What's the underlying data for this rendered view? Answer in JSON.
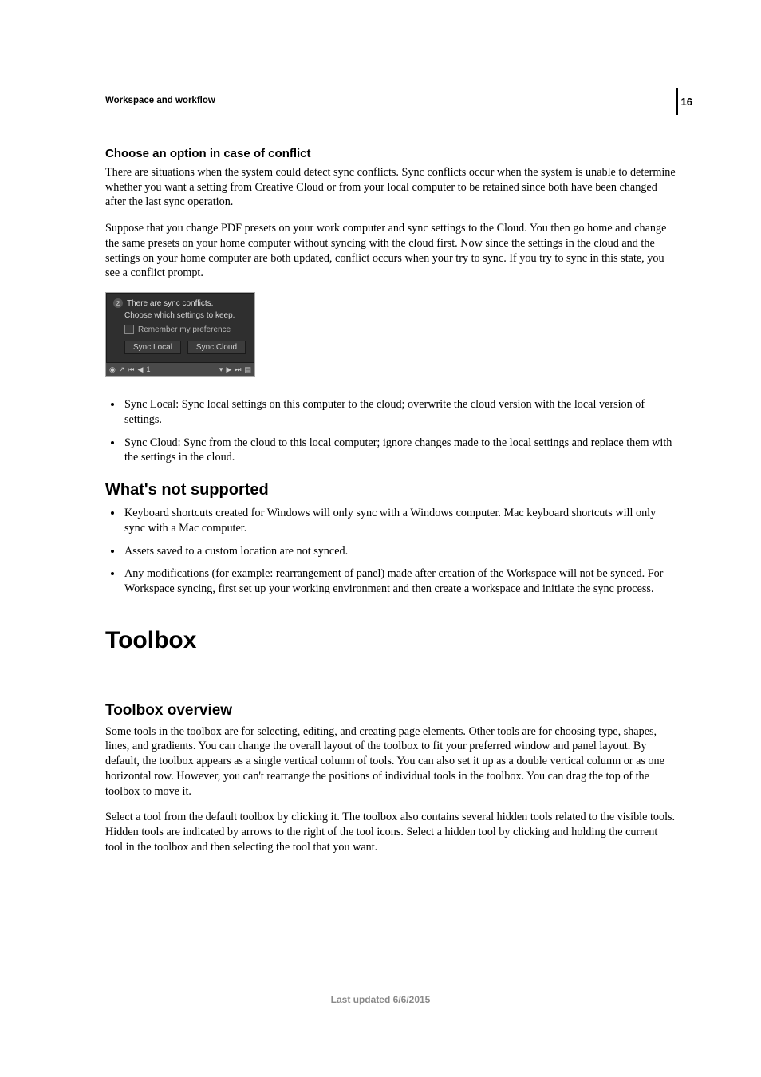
{
  "page_number": "16",
  "running_head": "Workspace and workflow",
  "h_conflict": "Choose an option in case of conflict",
  "p_conflict_1": "There are situations when the system could detect sync conflicts. Sync conflicts occur when the system is unable to determine whether you want a setting from Creative Cloud or from your local computer to be retained since both have been changed after the last sync operation.",
  "p_conflict_2": "Suppose that you change PDF presets on your work computer and sync settings to the Cloud. You then go home and change the same presets on your home computer without syncing with the cloud first. Now since the settings in the cloud and the settings on your home computer are both updated, conflict occurs when your try to sync. If you try to sync in this state, you see a conflict prompt.",
  "dialog": {
    "title": "There are sync conflicts.",
    "subtitle": "Choose which settings to keep.",
    "remember": "Remember my preference",
    "btn_local": "Sync Local",
    "btn_cloud": "Sync Cloud",
    "status_page": "1"
  },
  "sync_options": [
    "Sync Local: Sync local settings on this computer to the cloud; overwrite the cloud version with the local version of settings.",
    "Sync Cloud: Sync from the cloud to this local computer; ignore changes made to the local settings and replace them with the settings in the cloud."
  ],
  "h_notsupported": " What's not supported",
  "not_supported": [
    "Keyboard shortcuts created for Windows will only sync with a Windows computer. Mac keyboard shortcuts will only sync with a Mac computer.",
    "Assets saved to a custom location are not synced.",
    "Any modifications (for example: rearrangement of panel) made after creation of the Workspace will not be synced. For Workspace syncing, first set up your working environment and then create a workspace and initiate the sync process."
  ],
  "h_toolbox": "Toolbox",
  "h_overview": "Toolbox overview",
  "p_overview_1": "Some tools in the toolbox are for selecting, editing, and creating page elements. Other tools are for choosing type, shapes, lines, and gradients. You can change the overall layout of the toolbox to fit your preferred window and panel layout. By default, the toolbox appears as a single vertical column of tools. You can also set it up as a double vertical column or as one horizontal row. However, you can't rearrange the positions of individual tools in the toolbox. You can drag the top of the toolbox to move it.",
  "p_overview_2": "Select a tool from the default toolbox by clicking it. The toolbox also contains several hidden tools related to the visible tools. Hidden tools are indicated by arrows to the right of the tool icons. Select a hidden tool by clicking and holding the current tool in the toolbox and then selecting the tool that you want.",
  "footer": "Last updated 6/6/2015"
}
